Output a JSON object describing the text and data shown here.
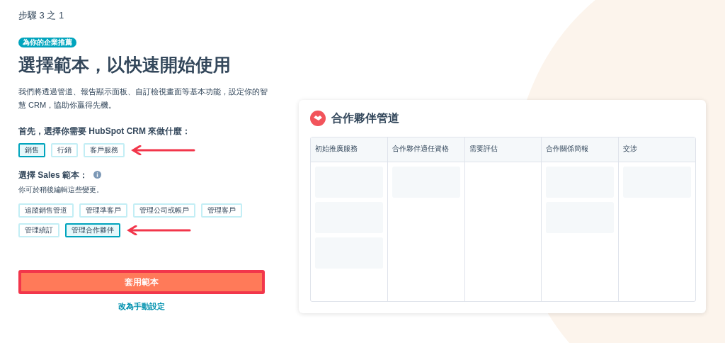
{
  "step": "步驟 3 之 1",
  "badge": "為你的企業推薦",
  "heading": "選擇範本，以快速開始使用",
  "intro": "我們將透過管道、報告顯示面板、自訂檢視畫面等基本功能，設定你的智慧 CRM，協助你贏得先機。",
  "purpose": {
    "label": "首先，選擇你需要 HubSpot CRM 來做什麼：",
    "options": [
      {
        "label": "銷售",
        "selected": true
      },
      {
        "label": "行銷",
        "selected": false
      },
      {
        "label": "客戶服務",
        "selected": false
      }
    ]
  },
  "templates": {
    "label": "選擇 Sales 範本：",
    "hint": "你可於稍後編輯這些變更。",
    "options": [
      {
        "label": "追蹤銷售管道",
        "selected": false
      },
      {
        "label": "管理準客戶",
        "selected": false
      },
      {
        "label": "管理公司或帳戶",
        "selected": false
      },
      {
        "label": "管理客戶",
        "selected": false
      },
      {
        "label": "管理續訂",
        "selected": false
      },
      {
        "label": "管理合作夥伴",
        "selected": true
      }
    ]
  },
  "apply_button": "套用範本",
  "manual_link": "改為手動設定",
  "preview": {
    "title": "合作夥伴管道",
    "columns": [
      {
        "label": "初始推廣服務",
        "cards": [
          {
            "kind": "blank"
          },
          {
            "kind": "blank"
          },
          {
            "kind": "blank"
          }
        ]
      },
      {
        "label": "合作夥伴適任資格",
        "cards": [
          {
            "kind": "blank"
          }
        ]
      },
      {
        "label": "需要評估"
      },
      {
        "label": "合作關係簡報",
        "cards": [
          {
            "kind": "blank"
          },
          {
            "kind": "blank"
          }
        ]
      },
      {
        "label": "交涉",
        "cards": [
          {
            "kind": "blank"
          }
        ]
      }
    ]
  }
}
